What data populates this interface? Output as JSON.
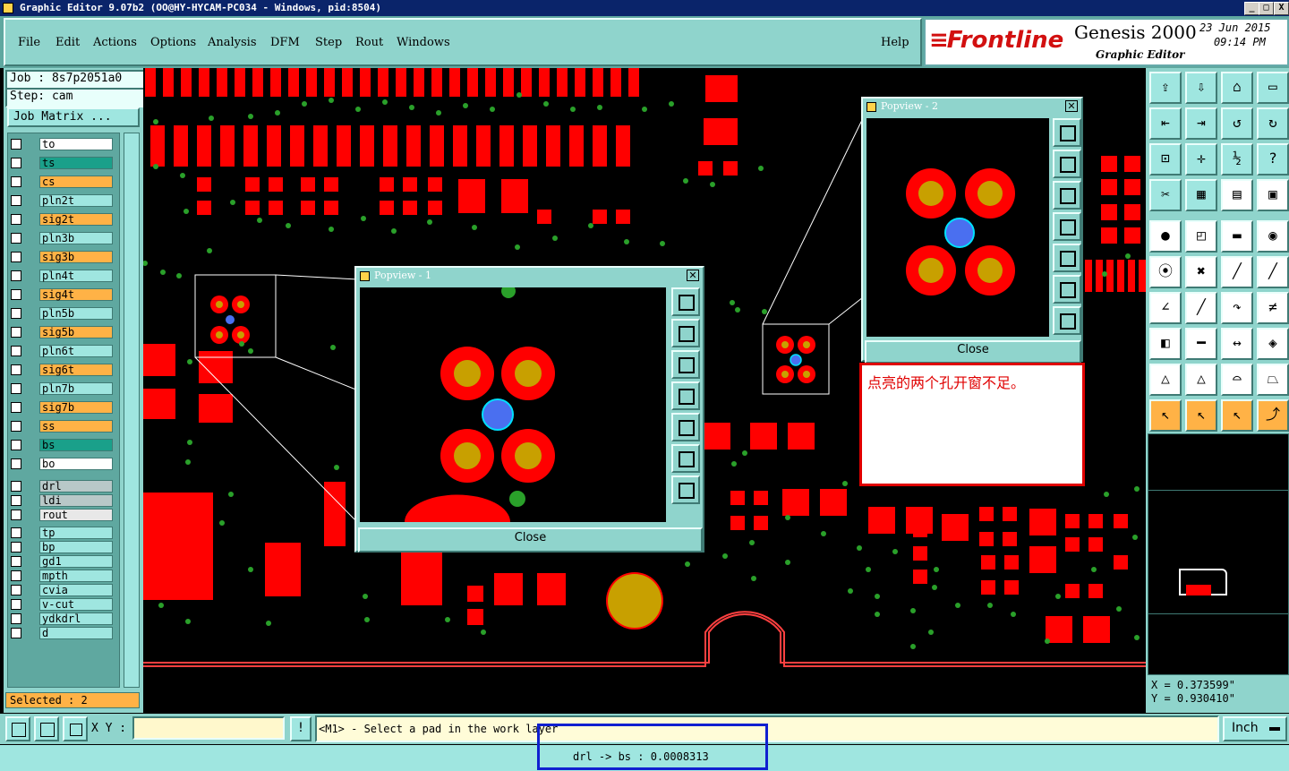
{
  "window": {
    "title": "Graphic Editor 9.07b2 (OO@HY-HYCAM-PC034 - Windows, pid:8504)",
    "min_label": "_",
    "max_label": "□",
    "close_label": "X"
  },
  "menu": {
    "items": [
      "File",
      "Edit",
      "Actions",
      "Options",
      "Analysis",
      "DFM",
      "Step",
      "Rout",
      "Windows"
    ],
    "help": "Help"
  },
  "brand": {
    "logo": "Frontline",
    "product": "Genesis 2000",
    "subtitle": "Graphic Editor",
    "date": "23 Jun 2015",
    "time": "09:14 PM"
  },
  "job": {
    "job_label": "Job : 8s7p2051a0",
    "step_label": "Step: cam",
    "matrix_button": "Job Matrix ..."
  },
  "layers": [
    {
      "name": "to",
      "color": "#ffffff"
    },
    {
      "name": "ts",
      "color": "#1aa08a"
    },
    {
      "name": "cs",
      "color": "#ffb246"
    },
    {
      "name": "pln2t",
      "color": "#9fe6e0"
    },
    {
      "name": "sig2t",
      "color": "#ffb246"
    },
    {
      "name": "pln3b",
      "color": "#9fe6e0"
    },
    {
      "name": "sig3b",
      "color": "#ffb246"
    },
    {
      "name": "pln4t",
      "color": "#9fe6e0"
    },
    {
      "name": "sig4t",
      "color": "#ffb246"
    },
    {
      "name": "pln5b",
      "color": "#9fe6e0"
    },
    {
      "name": "sig5b",
      "color": "#ffb246"
    },
    {
      "name": "pln6t",
      "color": "#9fe6e0"
    },
    {
      "name": "sig6t",
      "color": "#ffb246"
    },
    {
      "name": "pln7b",
      "color": "#9fe6e0"
    },
    {
      "name": "sig7b",
      "color": "#ffb246"
    },
    {
      "name": "ss",
      "color": "#ffb246"
    },
    {
      "name": "bs",
      "color": "#1aa08a"
    },
    {
      "name": "bo",
      "color": "#ffffff"
    },
    {
      "name": "drl",
      "color": "#b8c8c8"
    },
    {
      "name": "ldi",
      "color": "#b8c8c8"
    },
    {
      "name": "rout",
      "color": "#e8e8e8"
    },
    {
      "name": "tp",
      "color": "#9fe6e0"
    },
    {
      "name": "bp",
      "color": "#9fe6e0"
    },
    {
      "name": "gd1",
      "color": "#9fe6e0"
    },
    {
      "name": "mpth",
      "color": "#9fe6e0"
    },
    {
      "name": "cvia",
      "color": "#9fe6e0"
    },
    {
      "name": "v-cut",
      "color": "#9fe6e0"
    },
    {
      "name": "ydkdrl",
      "color": "#9fe6e0"
    },
    {
      "name": "d",
      "color": "#9fe6e0"
    }
  ],
  "selected_label": "Selected : 2",
  "popview1": {
    "title": "Popview - 1",
    "close": "Close"
  },
  "popview2": {
    "title": "Popview - 2",
    "close": "Close"
  },
  "annotation": "点亮的两个孔开窗不足。",
  "coords": {
    "x": "X = 0.373599\"",
    "y": "Y = 0.930410\""
  },
  "command": {
    "xy_label": "X Y :",
    "xy_value": "",
    "prompt": "<M1> - Select a pad in the work layer",
    "units": "Inch"
  },
  "status": "drl -> bs : 0.0008313",
  "colors": {
    "pad": "#ff0000",
    "drill": "#c8a000",
    "highlight": "#4a6ff0",
    "via": "#2aa02a",
    "panel": "#8fd4cc"
  }
}
